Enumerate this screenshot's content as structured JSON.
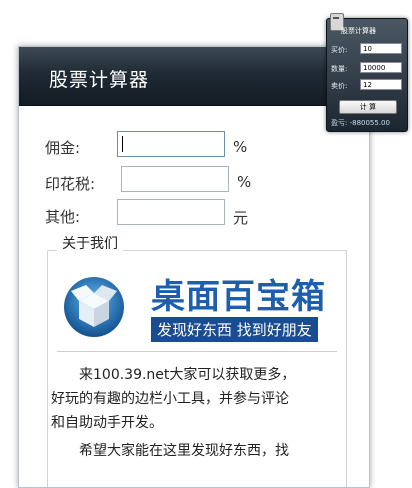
{
  "panel": {
    "title": "股票计算器",
    "fields": [
      {
        "label": "佣金:",
        "value": "",
        "unit": "%"
      },
      {
        "label": "印花税:",
        "value": "",
        "unit": "%"
      },
      {
        "label": "其他:",
        "value": "",
        "unit": "元"
      }
    ],
    "about": {
      "legend": "关于我们",
      "logo_text": "桌面百宝箱",
      "logo_slogan": "发现好东西 找到好朋友",
      "paragraph1_line1": "来100.39.net大家可以获取更多，",
      "paragraph1_line2": "好玩的有趣的边栏小工具，并参与评论",
      "paragraph1_line3": "和自助动手开发。",
      "paragraph2_line1": "希望大家能在这里发现好东西，找"
    }
  },
  "gadget": {
    "title": "股票计算器",
    "fields": [
      {
        "label": "买价:",
        "value": "10"
      },
      {
        "label": "数量:",
        "value": "10000"
      },
      {
        "label": "卖价:",
        "value": "12"
      }
    ],
    "button_label": "计 算",
    "result": "盈亏: -880055.00"
  },
  "colors": {
    "header_dark": "#1f2a34",
    "logo_blue": "#1b5fae",
    "slogan_bg": "#1a4c92"
  }
}
